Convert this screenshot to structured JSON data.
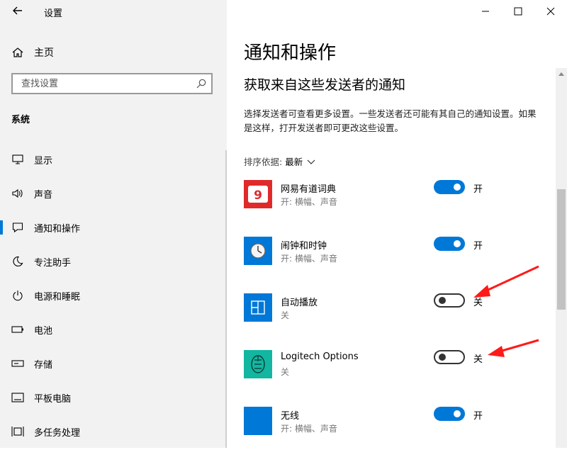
{
  "window": {
    "title": "设置"
  },
  "sidebar": {
    "home_label": "主页",
    "search_placeholder": "查找设置",
    "section_label": "系统",
    "items": [
      {
        "label": "显示",
        "icon": "monitor-icon"
      },
      {
        "label": "声音",
        "icon": "speaker-icon"
      },
      {
        "label": "通知和操作",
        "icon": "notification-icon",
        "active": true
      },
      {
        "label": "专注助手",
        "icon": "moon-icon"
      },
      {
        "label": "电源和睡眠",
        "icon": "power-icon"
      },
      {
        "label": "电池",
        "icon": "battery-icon"
      },
      {
        "label": "存储",
        "icon": "storage-icon"
      },
      {
        "label": "平板电脑",
        "icon": "tablet-icon"
      },
      {
        "label": "多任务处理",
        "icon": "multitask-icon"
      }
    ]
  },
  "main": {
    "title": "通知和操作",
    "subtitle": "获取来自这些发送者的通知",
    "description": "选择发送者可查看更多设置。一些发送者还可能有其自己的通知设置。如果是这样，打开发送者即可更改这些设置。",
    "sort_label": "排序依据:",
    "sort_value": "最新",
    "apps": [
      {
        "name": "网易有道词典",
        "sub": "开: 横幅、声音",
        "state": "开",
        "on": true,
        "icon": "youdao-dict-icon"
      },
      {
        "name": "闹钟和时钟",
        "sub": "开: 横幅、声音",
        "state": "开",
        "on": true,
        "icon": "alarm-clock-icon"
      },
      {
        "name": "自动播放",
        "sub": "关",
        "state": "关",
        "on": false,
        "icon": "autoplay-icon"
      },
      {
        "name": "Logitech Options",
        "sub": "关",
        "state": "关",
        "on": false,
        "icon": "logitech-options-icon"
      },
      {
        "name": "无线",
        "sub": "开: 横幅、声音",
        "state": "开",
        "on": true,
        "icon": "wireless-icon"
      }
    ]
  },
  "colors": {
    "accent": "#0078d7",
    "annotation": "#ff1a1a"
  }
}
